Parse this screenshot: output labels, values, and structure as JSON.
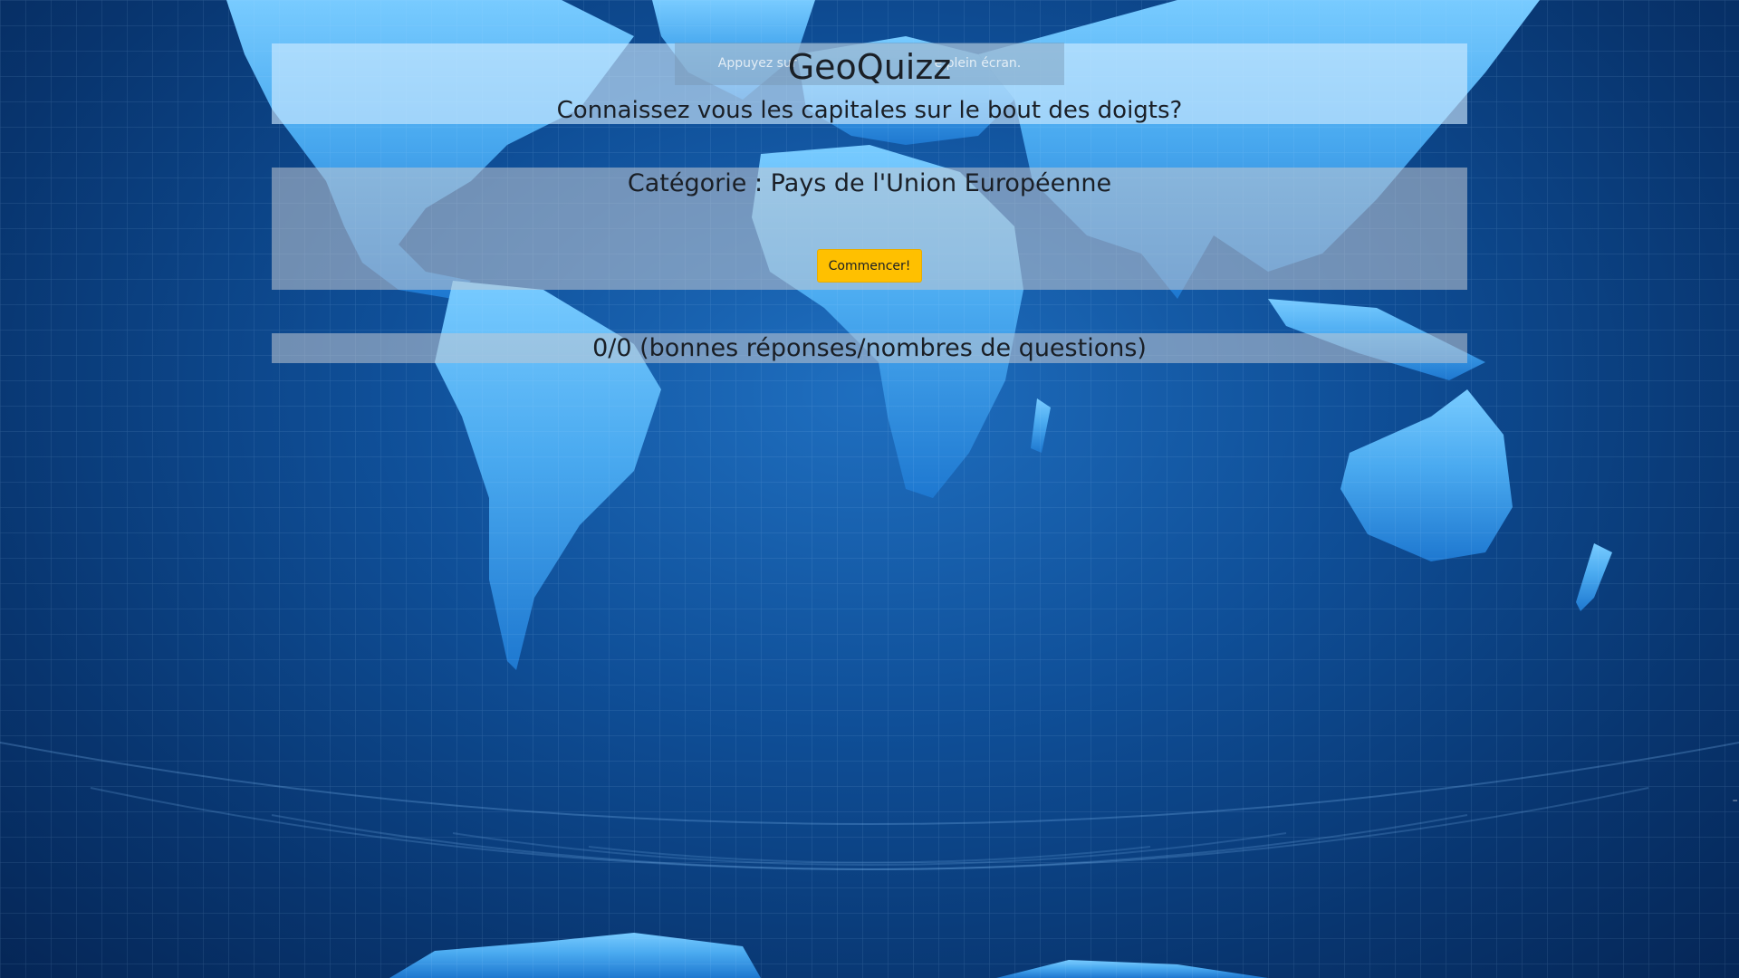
{
  "app": {
    "title": "GeoQuizz",
    "subtitle": "Connaissez vous les capitales sur le bout des doigts?"
  },
  "fullscreen_notice": {
    "prefix": "Appuyez sur",
    "suffix": "e plein écran."
  },
  "quiz": {
    "category_label": "Catégorie : Pays de l'Union Européenne",
    "start_button_label": "Commencer!",
    "score_text": "0/0 (bonnes réponses/nombres de questions)"
  },
  "background": {
    "image": "world-map",
    "colors": {
      "ocean_deep": "#052656",
      "ocean_mid": "#0f4f98",
      "land": "#5ab8f5",
      "button_accent": "#ffc000"
    }
  }
}
